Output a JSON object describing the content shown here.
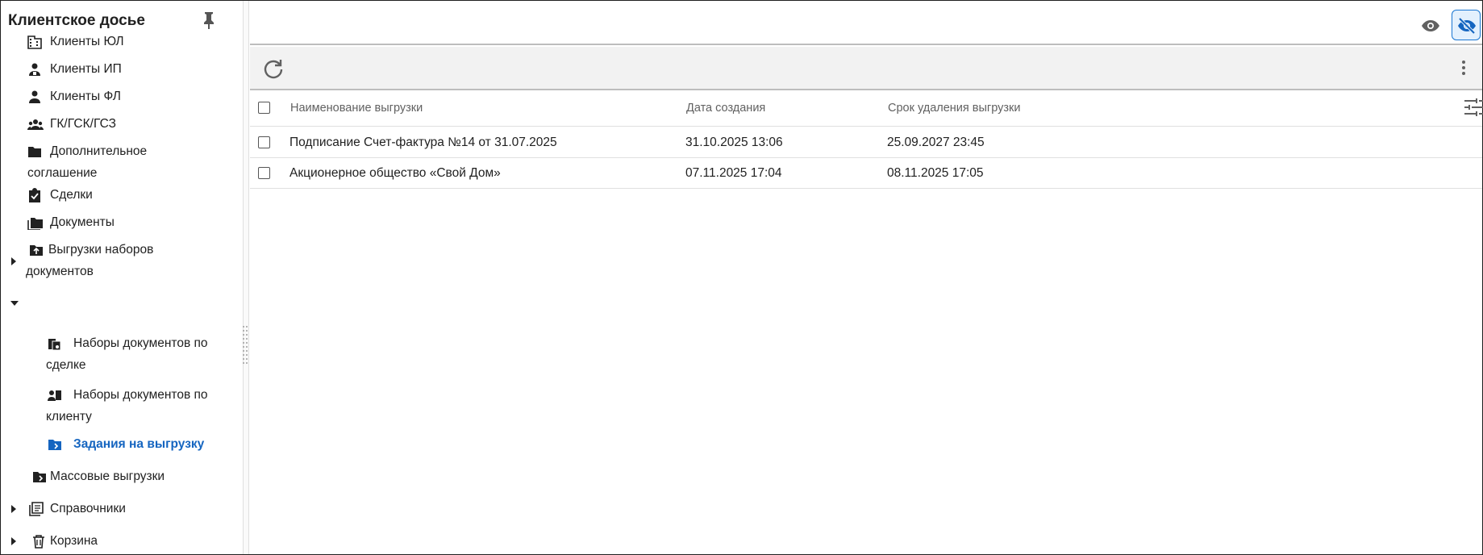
{
  "sidebar": {
    "title": "Клиентское досье",
    "items": [
      {
        "label": "Клиенты ЮЛ",
        "icon": "building-icon"
      },
      {
        "label": "Клиенты ИП",
        "icon": "person-badge-icon"
      },
      {
        "label": "Клиенты ФЛ",
        "icon": "person-icon"
      },
      {
        "label": "ГК/ГСК/ГСЗ",
        "icon": "group-icon"
      },
      {
        "label_line1": "Дополнительное",
        "label_line2": "соглашение",
        "icon": "folder-icon"
      },
      {
        "label": "Сделки",
        "icon": "clipboard-check-icon"
      },
      {
        "label": "Документы",
        "icon": "folders-icon"
      },
      {
        "label_line1": "Выгрузки наборов",
        "label_line2": "документов",
        "icon": "folder-upload-icon"
      },
      {
        "label_line1": "Наборы документов по",
        "label_line2": "сделке",
        "icon": "docs-deal-icon"
      },
      {
        "label_line1": "Наборы документов по",
        "label_line2": "клиенту",
        "icon": "docs-client-icon"
      },
      {
        "label": "Задания на выгрузку",
        "icon": "folder-task-icon"
      },
      {
        "label": "Массовые выгрузки",
        "icon": "folder-mass-icon"
      },
      {
        "label": "Справочники",
        "icon": "list-book-icon"
      },
      {
        "label": "Корзина",
        "icon": "trash-icon"
      }
    ]
  },
  "table": {
    "headers": [
      "Наименование выгрузки",
      "Дата создания",
      "Срок удаления выгрузки"
    ],
    "rows": [
      [
        "Подписание Счет-фактура №14 от 31.07.2025",
        "31.10.2025 13:06",
        "25.09.2027 23:45"
      ],
      [
        "Акционерное общество «Свой Дом»",
        "07.11.2025 17:04",
        "08.11.2025 17:05"
      ]
    ]
  },
  "colors": {
    "accent": "#1565c0",
    "text": "#212121",
    "muted": "#616161",
    "toolbar": "#f2f2f2"
  }
}
